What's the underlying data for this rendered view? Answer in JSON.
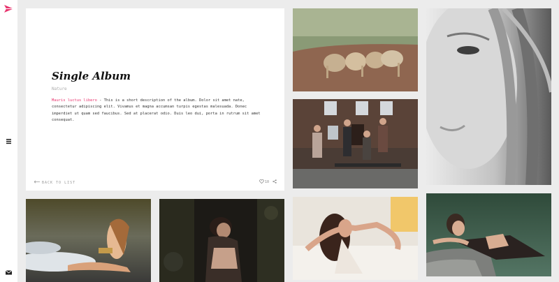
{
  "sidebar": {
    "logo_icon": "paper-plane-logo-icon",
    "menu_icon": "hamburger-menu-icon",
    "mail_icon": "envelope-icon",
    "accent_color": "#e8336d"
  },
  "album": {
    "title": "Single Album",
    "category": "Nature",
    "desc_link": "Mauris luctus libero",
    "desc_text": " - This is a short description of the album. Dolor sit amet nate, consectetur adipiscing elit. Vivamus et magna accumsan turpis egestas malesuada. Donec imperdiet ut quam sed faucibus. Sed at placerat odio. Duis leo dui, porta in rutrum sit amet consequat.",
    "back_label": "BACK TO LIST",
    "likes": "10"
  },
  "photos": [
    {
      "subject": "lions-on-dirt-path"
    },
    {
      "subject": "portrait-face-with-hair"
    },
    {
      "subject": "group-on-bench-outside-building"
    },
    {
      "subject": "woman-lying-on-beach-waves"
    },
    {
      "subject": "woman-in-dark-forest"
    },
    {
      "subject": "woman-in-bathtub"
    },
    {
      "subject": "woman-leaning-on-rock-by-lake"
    }
  ]
}
